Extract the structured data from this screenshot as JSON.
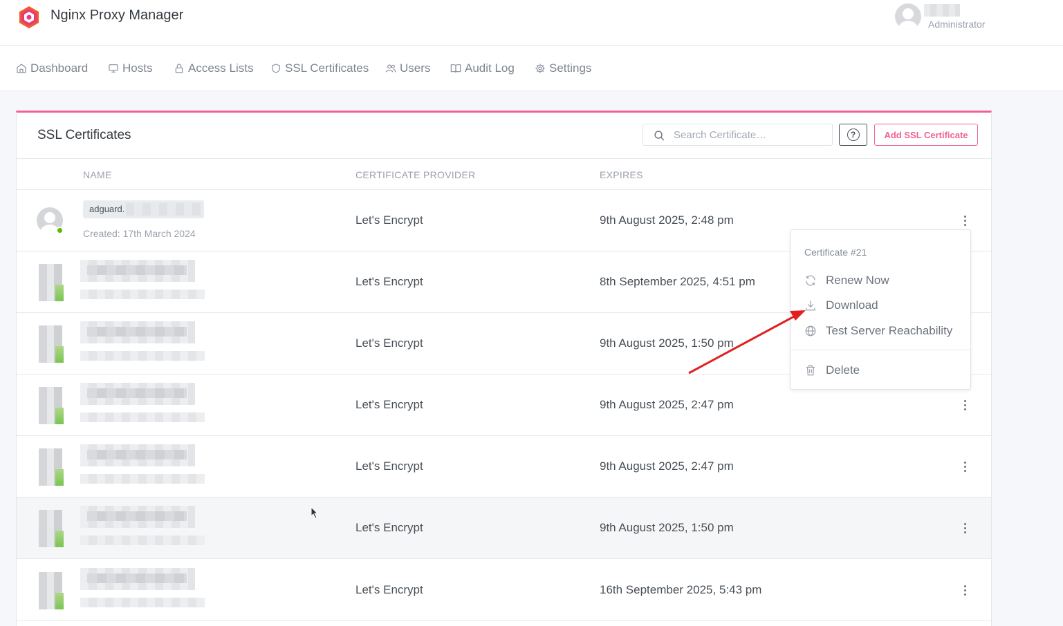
{
  "app": {
    "title": "Nginx Proxy Manager",
    "user_role": "Administrator"
  },
  "nav": [
    {
      "label": "Dashboard",
      "icon": "home-icon"
    },
    {
      "label": "Hosts",
      "icon": "monitor-icon"
    },
    {
      "label": "Access Lists",
      "icon": "lock-icon"
    },
    {
      "label": "SSL Certificates",
      "icon": "shield-icon"
    },
    {
      "label": "Users",
      "icon": "users-icon"
    },
    {
      "label": "Audit Log",
      "icon": "book-icon"
    },
    {
      "label": "Settings",
      "icon": "gear-icon"
    }
  ],
  "card": {
    "title": "SSL Certificates",
    "search_placeholder": "Search Certificate…",
    "help_label": "?",
    "add_button": "Add SSL Certificate",
    "accent_color": "#f06292"
  },
  "table": {
    "headers": {
      "name": "NAME",
      "provider": "CERTIFICATE PROVIDER",
      "expires": "EXPIRES"
    },
    "rows": [
      {
        "name": "adguard.",
        "created": "Created: 17th March 2024",
        "provider": "Let's Encrypt",
        "expires": "9th August 2025, 2:48 pm",
        "status_color": "#5eba00"
      },
      {
        "provider": "Let's Encrypt",
        "expires": "8th September 2025, 4:51 pm"
      },
      {
        "provider": "Let's Encrypt",
        "expires": "9th August 2025, 1:50 pm"
      },
      {
        "provider": "Let's Encrypt",
        "expires": "9th August 2025, 2:47 pm"
      },
      {
        "provider": "Let's Encrypt",
        "expires": "9th August 2025, 2:47 pm"
      },
      {
        "provider": "Let's Encrypt",
        "expires": "9th August 2025, 1:50 pm"
      },
      {
        "provider": "Let's Encrypt",
        "expires": "16th September 2025, 5:43 pm"
      }
    ]
  },
  "dropdown": {
    "header": "Certificate #21",
    "items": [
      {
        "label": "Renew Now",
        "icon": "refresh-icon"
      },
      {
        "label": "Download",
        "icon": "download-icon"
      },
      {
        "label": "Test Server Reachability",
        "icon": "globe-icon"
      },
      {
        "label": "Delete",
        "icon": "trash-icon"
      }
    ]
  },
  "annotation": {
    "arrow_color": "#e02020"
  }
}
